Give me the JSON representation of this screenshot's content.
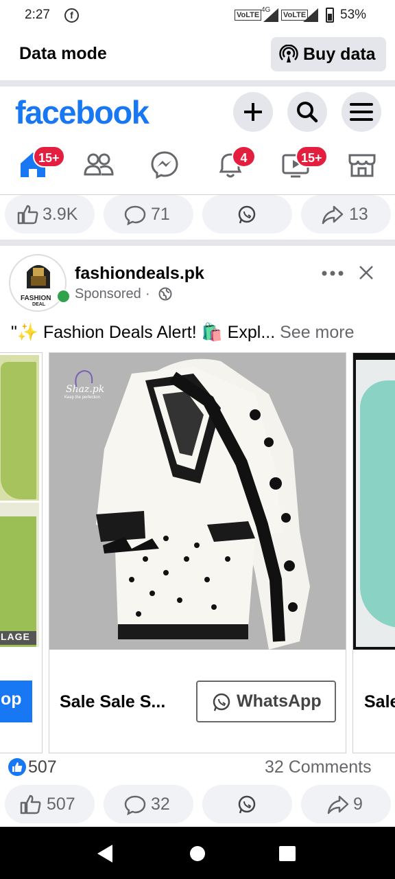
{
  "status_bar": {
    "time": "2:27",
    "app_badge": "f",
    "volte1": "VoLTE",
    "net": "4G",
    "volte2": "VoLTE",
    "battery": "53%"
  },
  "data_mode": {
    "label": "Data mode",
    "buy_button": "Buy data"
  },
  "header": {
    "logo": "facebook"
  },
  "nav": {
    "home_badge": "15+",
    "notifications_badge": "4",
    "video_badge": "15+"
  },
  "prev_post_actions": {
    "likes": "3.9K",
    "comments": "71",
    "shares": "13"
  },
  "post": {
    "page_name": "fashiondeals.pk",
    "sponsored": "Sponsored",
    "avatar_text": "FASHION",
    "avatar_subtext": "DEAL",
    "text_start": "\"✨ Fashion Deals Alert! 🛍️ Expl...",
    "see_more": "See more",
    "watermark": "Shaz.pk",
    "watermark_sub": "Keep the perfection",
    "left_card_label": "LAGE",
    "left_card_button": "op",
    "card_title": "Sale Sale S...",
    "card_button": "WhatsApp",
    "right_card_title": "Sale",
    "reaction_count": "507",
    "comment_count": "32 Comments",
    "actions": {
      "likes": "507",
      "comments": "32",
      "shares": "9"
    }
  },
  "colors": {
    "brand": "#1877f2",
    "badge": "#e41e3f",
    "online": "#31a24c"
  }
}
